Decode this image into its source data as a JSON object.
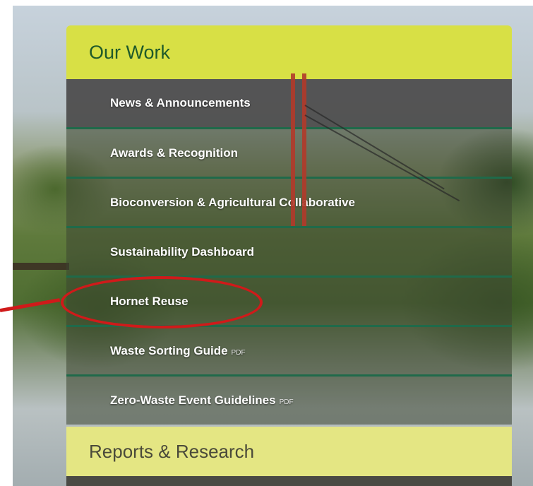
{
  "menu": {
    "header_title": "Our Work",
    "items": [
      {
        "label": "News & Announcements",
        "badge": ""
      },
      {
        "label": "Awards & Recognition",
        "badge": ""
      },
      {
        "label": "Bioconversion & Agricultural Collaborative",
        "badge": ""
      },
      {
        "label": "Sustainability Dashboard",
        "badge": ""
      },
      {
        "label": "Hornet Reuse",
        "badge": ""
      },
      {
        "label": "Waste Sorting Guide",
        "badge": "PDF"
      },
      {
        "label": "Zero-Waste Event Guidelines",
        "badge": "PDF"
      }
    ],
    "footer_title": "Reports & Research"
  },
  "colors": {
    "header_bg": "#d8e045",
    "header_text": "#1f5a2a",
    "footer_bg": "#e4e683",
    "divider": "#1f6a4a",
    "highlight": "#d01a1a"
  }
}
